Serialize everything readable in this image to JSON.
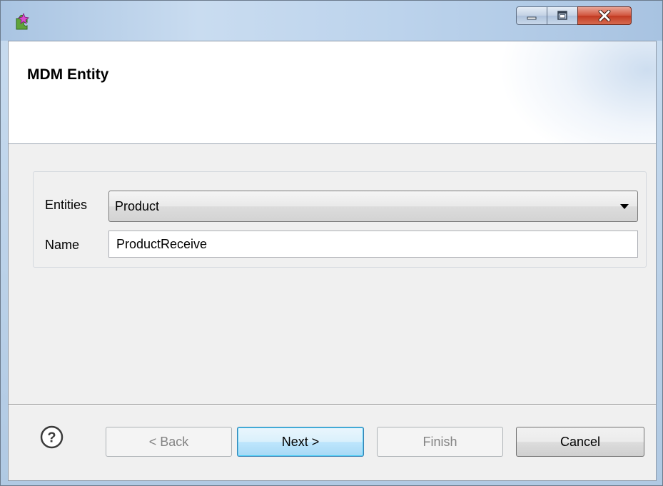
{
  "window": {
    "title": "",
    "icon": "puzzle-wizard-icon"
  },
  "title_bar_controls": {
    "minimize": "minimize-icon",
    "maximize": "maximize-icon",
    "close": "close-icon"
  },
  "header": {
    "title": "MDM Entity"
  },
  "form": {
    "entities_label": "Entities",
    "entities_value": "Product",
    "name_label": "Name",
    "name_value": "ProductReceive"
  },
  "footer": {
    "help_icon": "help-icon",
    "back_label": "< Back",
    "next_label": "Next >",
    "finish_label": "Finish",
    "cancel_label": "Cancel"
  },
  "colors": {
    "close_button": "#c23a22",
    "default_button_border": "#3c7fb1",
    "dialog_background": "#f0f0f0"
  }
}
